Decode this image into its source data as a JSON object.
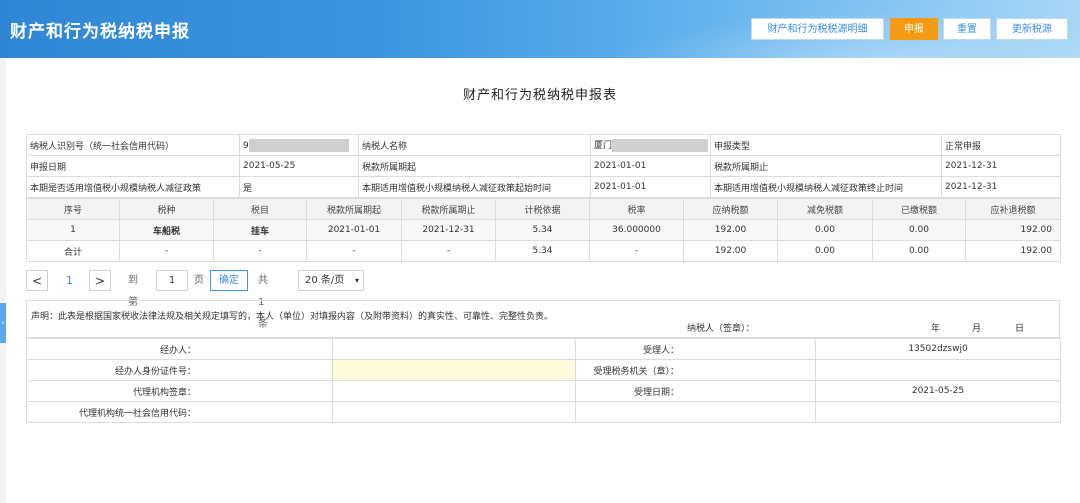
{
  "header": {
    "title": "财产和行为税纳税申报",
    "buttons": {
      "detail": "财产和行为税税源明细",
      "submit": "申报",
      "reset": "重置",
      "update": "更新税源"
    }
  },
  "colors": {
    "header_blue": "#3a95e0",
    "accent_orange": "#f59a12",
    "link_blue": "#3a8ee6"
  },
  "doc_title": "财产和行为税纳税申报表",
  "info": {
    "taxpayer_id_label": "纳税人识别号（统一社会信用代码）",
    "taxpayer_id_value": "9",
    "taxpayer_name_label": "纳税人名称",
    "taxpayer_name_value": "厦门",
    "decl_type_label": "申报类型",
    "decl_type_value": "正常申报",
    "decl_date_label": "申报日期",
    "decl_date_value": "2021-05-25",
    "period_start_label": "税款所属期起",
    "period_start_value": "2021-01-01",
    "period_end_label": "税款所属期止",
    "period_end_value": "2021-12-31",
    "policy_label": "本期是否适用增值税小规模纳税人减征政策",
    "policy_value": "是",
    "policy_start_label": "本期适用增值税小规模纳税人减征政策起始时间",
    "policy_start_value": "2021-01-01",
    "policy_end_label": "本期适用增值税小规模纳税人减征政策终止时间",
    "policy_end_value": "2021-12-31"
  },
  "detail": {
    "headers": [
      "序号",
      "税种",
      "税目",
      "税款所属期起",
      "税款所属期止",
      "计税依据",
      "税率",
      "应纳税额",
      "减免税额",
      "已缴税额",
      "应补退税额"
    ],
    "row1": [
      "1",
      "车船税",
      "挂车",
      "2021-01-01",
      "2021-12-31",
      "5.34",
      "36.000000",
      "192.00",
      "0.00",
      "0.00",
      "192.00"
    ],
    "total": [
      "合计",
      "-",
      "-",
      "-",
      "-",
      "5.34",
      "-",
      "192.00",
      "0.00",
      "0.00",
      "192.00"
    ]
  },
  "pager": {
    "prev": "<",
    "current": "1",
    "next": ">",
    "goto_label": "到第",
    "goto_value": "1",
    "page_unit": "页",
    "confirm": "确定",
    "total": "共 1 条",
    "page_size": "20 条/页",
    "page_size_arrow": "▾"
  },
  "declaration": {
    "statement": "声明：此表是根据国家税收法律法规及相关规定填写的，本人（单位）对填报内容（及附带资料）的真实性、可靠性、完整性负责。",
    "signature_label": "纳税人（签章）：",
    "year": "年",
    "month": "月",
    "day": "日"
  },
  "signatures": {
    "agent_label": "经办人：",
    "agent_value": "",
    "receiver_label": "受理人：",
    "receiver_value": "13502dzswj0",
    "agent_id_label": "经办人身份证件号：",
    "agent_id_value": "",
    "tax_office_label": "受理税务机关（章）：",
    "tax_office_value": "",
    "agency_seal_label": "代理机构签章：",
    "agency_seal_value": "",
    "accept_date_label": "受理日期：",
    "accept_date_value": "2021-05-25",
    "agency_code_label": "代理机构统一社会信用代码：",
    "agency_code_value": ""
  }
}
